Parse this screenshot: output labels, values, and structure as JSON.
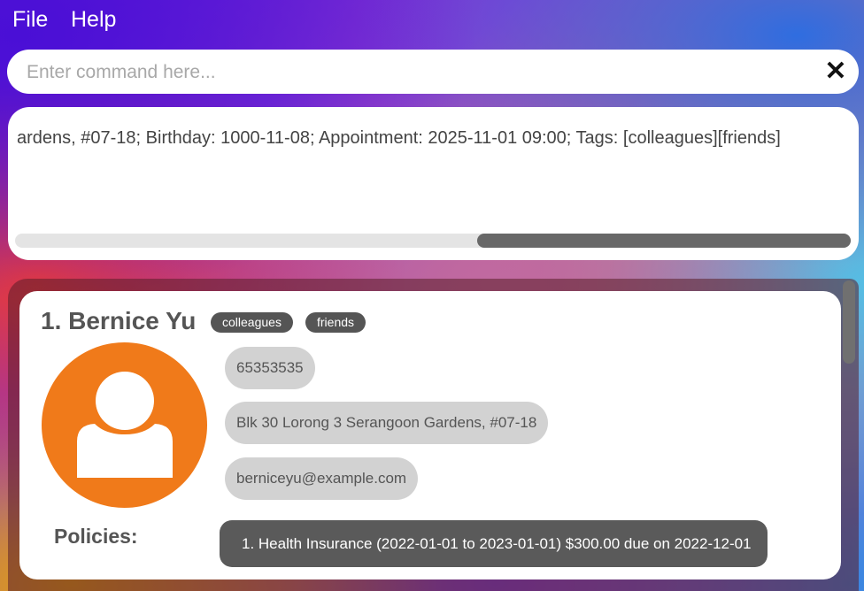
{
  "menu": {
    "file_label": "File",
    "help_label": "Help"
  },
  "command": {
    "placeholder": "Enter command here...",
    "value": "",
    "clear_icon": "close-icon"
  },
  "result": {
    "text": "ardens, #07-18; Birthday: 1000-11-08; Appointment: 2025-11-01 09:00; Tags: [colleagues][friends]"
  },
  "persons": [
    {
      "index_name": "1. Bernice Yu",
      "tags": [
        "colleagues",
        "friends"
      ],
      "avatar_icon": "person-icon",
      "avatar_color": "#f07a1a",
      "phone": "65353535",
      "address": "Blk 30 Lorong 3 Serangoon Gardens, #07-18",
      "email": "berniceyu@example.com",
      "policies_label": "Policies:",
      "policies": [
        "1. Health Insurance (2022-01-01 to 2023-01-01) $300.00 due on 2022-12-01"
      ]
    }
  ]
}
